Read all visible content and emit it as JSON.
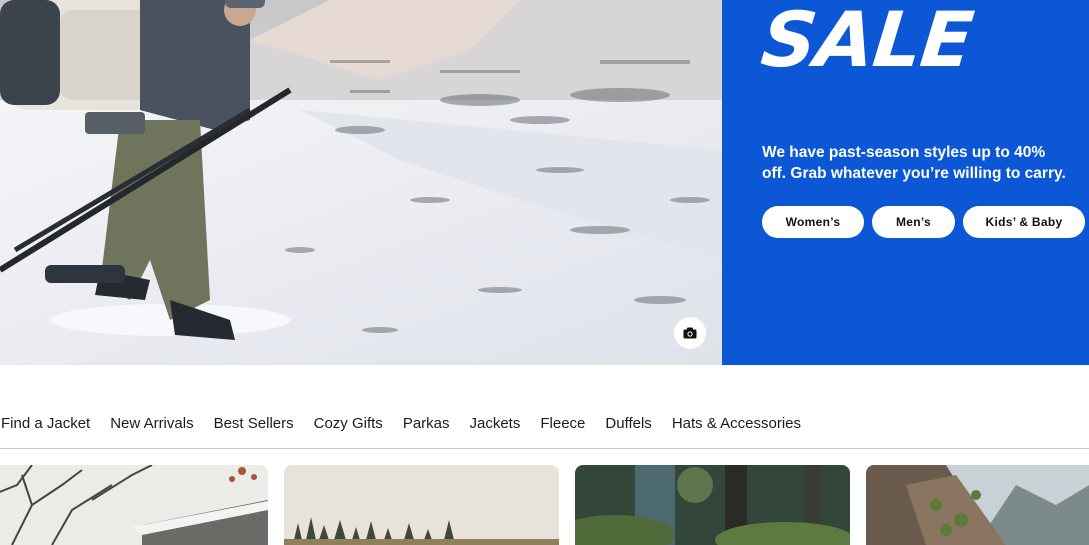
{
  "hero": {
    "image_alt_icon": "camera-icon",
    "promo": {
      "title": "SALE",
      "description": "We have past-season styles up to 40% off. Grab whatever you’re willing to carry.",
      "buttons": [
        "Women’s",
        "Men’s",
        "Kids’ & Baby"
      ],
      "background_color": "#0b57d6"
    }
  },
  "category_nav": {
    "items": [
      "Find a Jacket",
      "New Arrivals",
      "Best Sellers",
      "Cozy Gifts",
      "Parkas",
      "Jackets",
      "Fleece",
      "Duffels",
      "Hats & Accessories"
    ]
  }
}
